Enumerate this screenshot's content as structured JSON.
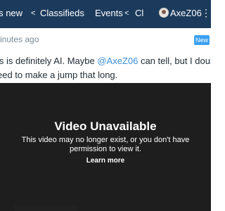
{
  "nav": {
    "items": [
      {
        "label": "t's new"
      },
      {
        "label": "Classifieds"
      },
      {
        "label": "Events"
      },
      {
        "label": "Cl"
      }
    ],
    "chevron": "<",
    "username": "AxeZ06",
    "more_icon": "⋮"
  },
  "post": {
    "timestamp": "inutes ago",
    "new_badge": "New",
    "comment_line1_before": "is is definitely AI. Maybe ",
    "comment_mention": "@AxeZ06",
    "comment_line1_after": " can tell, but I doubt the bik",
    "comment_line2": "eed to make a jump that long."
  },
  "video": {
    "title": "Video Unavailable",
    "message_line1": "This video may no longer exist, or you don't have",
    "message_line2": "permission to view it.",
    "learn_more": "Learn more"
  }
}
